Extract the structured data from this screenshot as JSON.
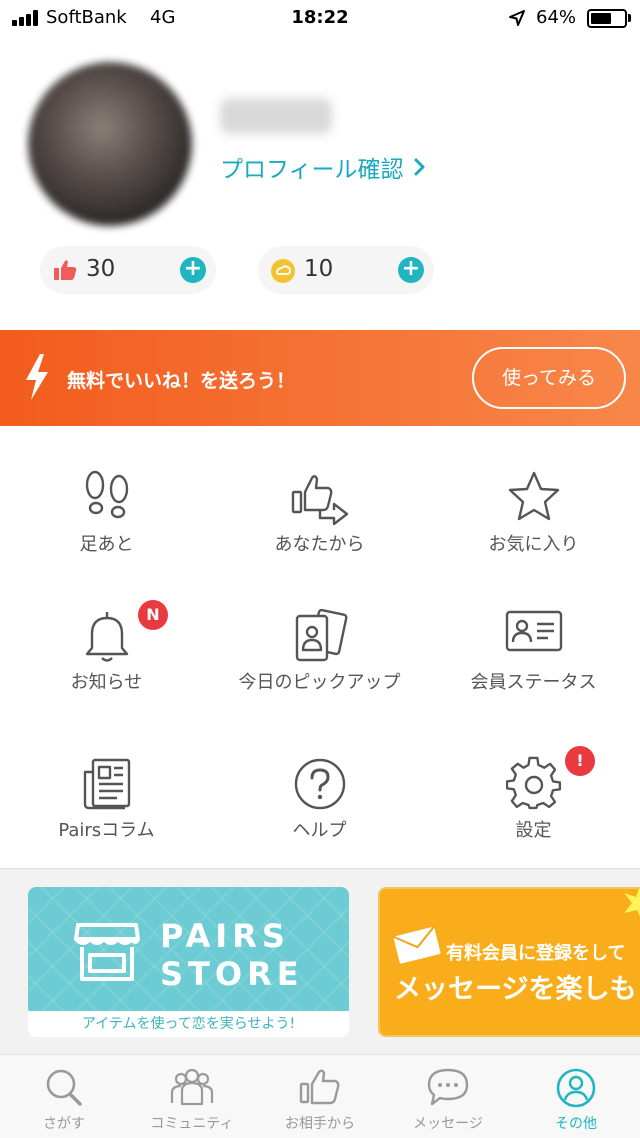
{
  "status_bar": {
    "carrier": "SoftBank",
    "network": "4G",
    "time": "18:22",
    "battery": "64%",
    "battery_level": 0.64
  },
  "profile": {
    "name": "",
    "link_label": "プロフィール確認"
  },
  "stats": {
    "likes": "30",
    "coins": "10"
  },
  "promo": {
    "text": "無料でいいね！を送ろう！",
    "button": "使ってみる"
  },
  "menu": {
    "footprints": "足あと",
    "from_you": "あなたから",
    "favorites": "お気に入り",
    "notifications": "お知らせ",
    "notifications_badge": "N",
    "todays_pickup": "今日のピックアップ",
    "member_status": "会員ステータス",
    "pairs_column": "Pairsコラム",
    "help": "ヘルプ",
    "settings": "設定",
    "settings_badge": "!"
  },
  "store_banner": {
    "title_line1": "PAIRS",
    "title_line2": "STORE",
    "caption": "アイテムを使って恋を実らせよう!"
  },
  "message_banner": {
    "line1": "有料会員に登録をして",
    "line2": "メッセージを楽しも"
  },
  "tabs": {
    "search": "さがす",
    "community": "コミュニティ",
    "from_partner": "お相手から",
    "messages": "メッセージ",
    "other": "その他"
  },
  "colors": {
    "accent": "#1fb5c1",
    "promo_start": "#f25c1d",
    "promo_end": "#f8874a",
    "badge": "#e83a3f"
  }
}
